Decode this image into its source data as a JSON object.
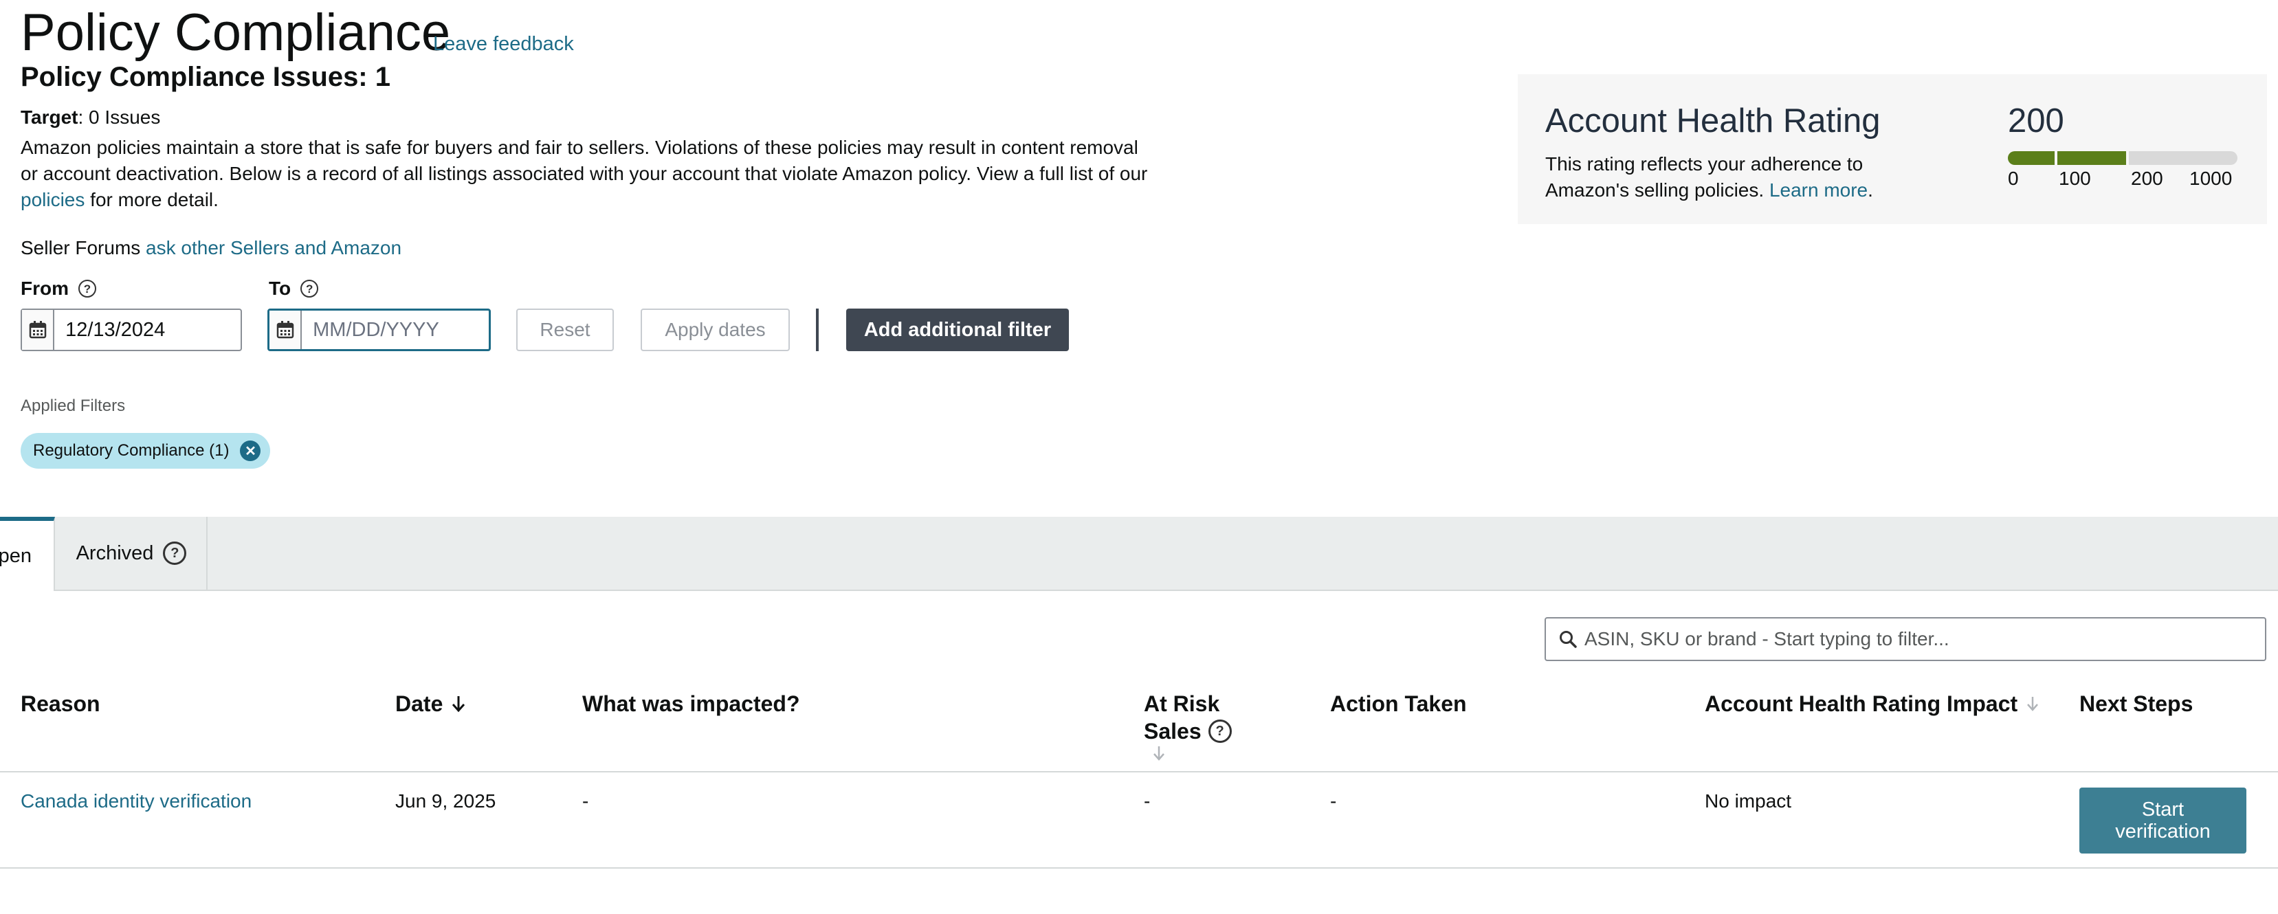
{
  "header": {
    "title": "Policy Compliance",
    "feedback_link": "Leave feedback",
    "issues_heading": "Policy Compliance Issues: 1",
    "target_label": "Target",
    "target_value": ": 0 Issues",
    "description_part1": "Amazon policies maintain a store that is safe for buyers and fair to sellers. Violations of these policies may result in content removal or account deactivation. Below is a record of all listings associated with your account that violate Amazon policy. View a full list of our ",
    "description_link": "policies",
    "description_part2": " for more detail.",
    "forums_label": "Seller Forums ",
    "forums_link": "ask other Sellers and Amazon"
  },
  "date_filter": {
    "from_label": "From",
    "from_value": "12/13/2024",
    "to_label": "To",
    "to_placeholder": "MM/DD/YYYY",
    "reset_label": "Reset",
    "apply_label": "Apply dates",
    "add_filter_label": "Add additional filter"
  },
  "applied_filters": {
    "label": "Applied Filters",
    "chips": [
      {
        "label": "Regulatory Compliance (1)"
      }
    ]
  },
  "account_health": {
    "title": "Account Health Rating",
    "description": "This rating reflects your adherence to Amazon's selling policies. ",
    "learn_more": "Learn more",
    "score": "200",
    "ticks": [
      "0",
      "100",
      "200",
      "1000"
    ],
    "colors": {
      "filled": "#5b7f1a",
      "empty": "#d9d9d9"
    }
  },
  "tabs": [
    {
      "label": "pen",
      "active": true
    },
    {
      "label": "Archived",
      "active": false
    }
  ],
  "search": {
    "placeholder": "ASIN, SKU or brand - Start typing to filter..."
  },
  "table": {
    "columns": {
      "reason": "Reason",
      "date": "Date",
      "impacted": "What was impacted?",
      "at_risk_1": "At Risk",
      "at_risk_2": "Sales",
      "action": "Action Taken",
      "ahr_impact": "Account Health Rating Impact",
      "next_steps": "Next Steps"
    },
    "rows": [
      {
        "reason": "Canada identity verification",
        "date": "Jun 9, 2025",
        "impacted": "-",
        "at_risk": "-",
        "action": "-",
        "ahr_impact": "No impact",
        "next_step_label": "Start verification"
      }
    ]
  }
}
